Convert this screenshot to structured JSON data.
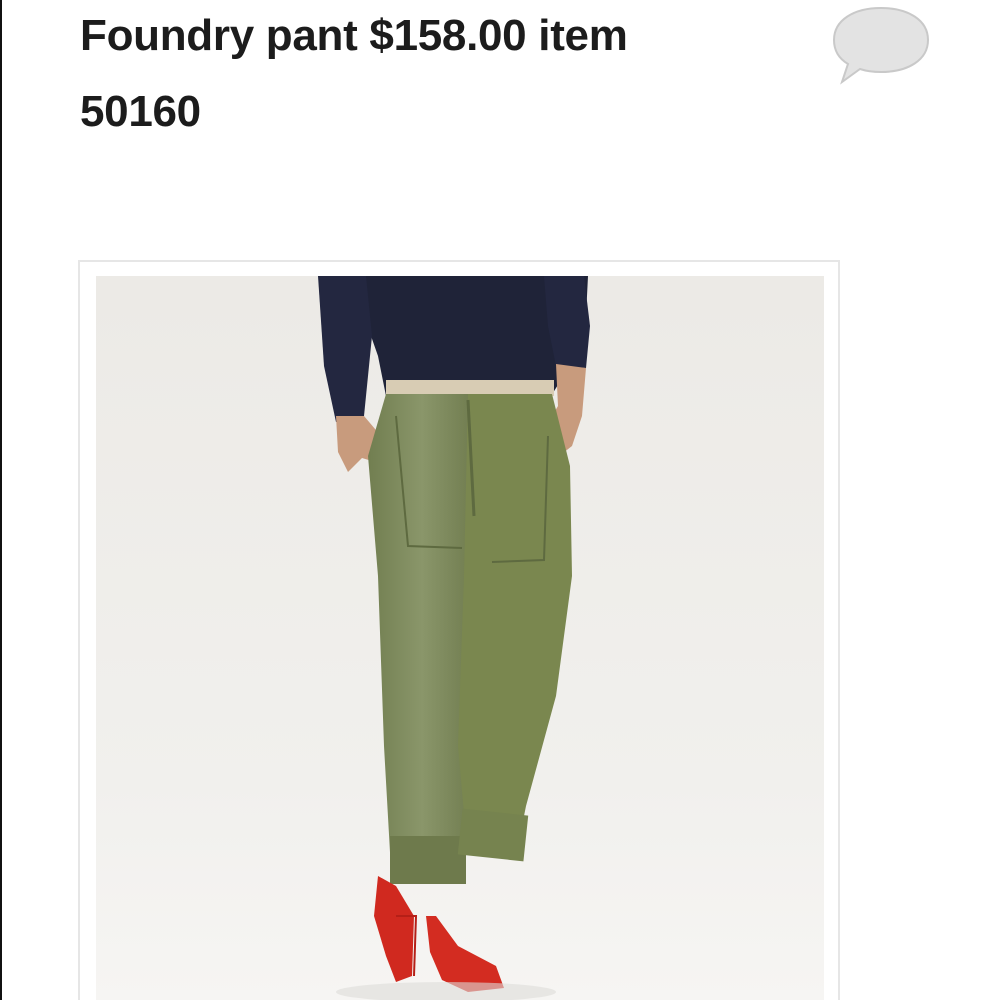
{
  "listing": {
    "title_line1": "Foundry pant $158.00 item",
    "title_line2": "50160"
  },
  "icons": {
    "comment": "speech-bubble-icon"
  },
  "colors": {
    "background": "#ffffff",
    "text": "#1c1c1c",
    "bubble": "#e3e3e3",
    "pants": "#7d8a5a",
    "sweater": "#1f2338",
    "shoes": "#d0291f"
  }
}
